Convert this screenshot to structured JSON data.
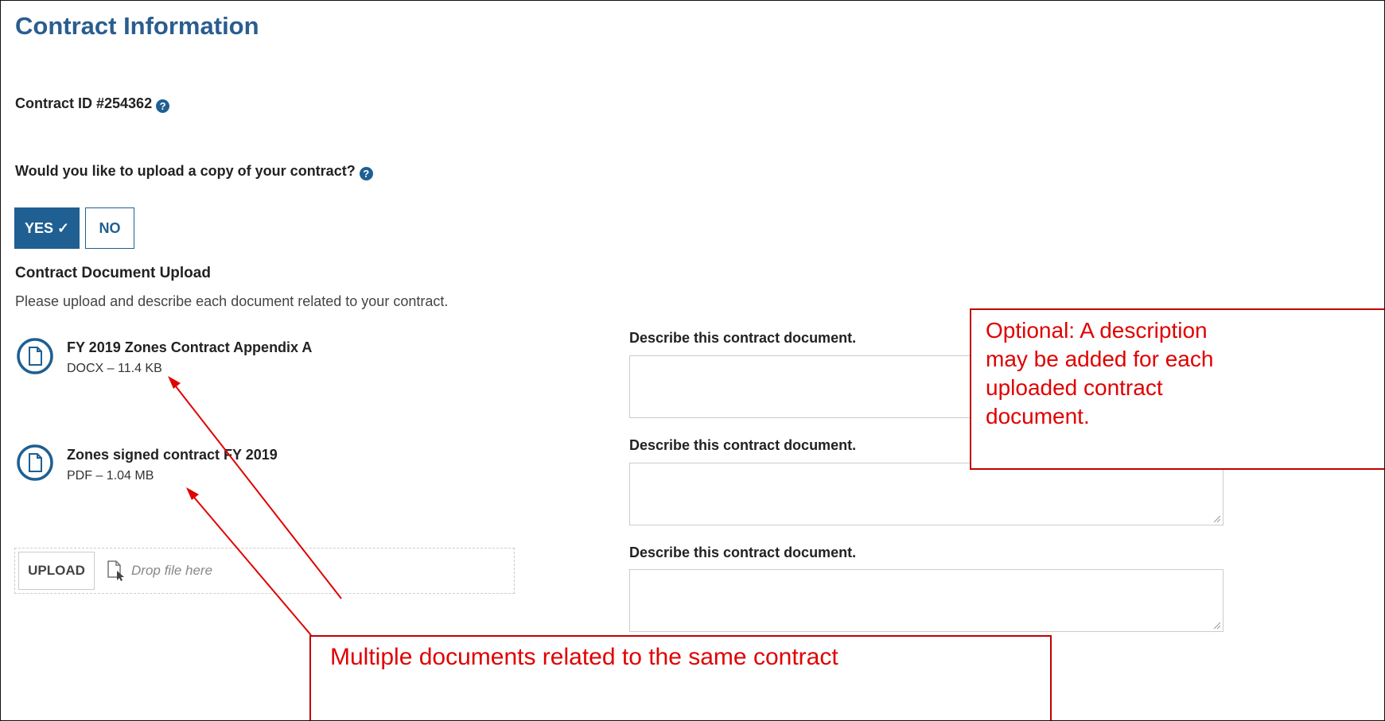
{
  "page": {
    "title": "Contract Information",
    "contract_id_label": "Contract ID #254362",
    "upload_question": "Would you like to upload a copy of your contract?",
    "help_icon": "question-circle-icon"
  },
  "toggle": {
    "yes_label": "YES ✓",
    "no_label": "NO",
    "selected": "YES"
  },
  "upload": {
    "heading": "Contract Document Upload",
    "instructions": "Please upload and describe each document related to your contract.",
    "files": [
      {
        "name": "FY 2019 Zones Contract Appendix A",
        "meta": "DOCX – 11.4 KB",
        "icon": "file-icon"
      },
      {
        "name": "Zones signed contract FY 2019",
        "meta": "PDF – 1.04 MB",
        "icon": "file-icon"
      }
    ],
    "describe_label": "Describe this contract document.",
    "upload_button": "UPLOAD",
    "drop_placeholder": "Drop file here"
  },
  "callouts": {
    "description_note": [
      "Optional:  A description",
      "may be added for each",
      "uploaded contract",
      "document."
    ],
    "multiple_docs_note": "Multiple documents related to the same contract"
  },
  "colors": {
    "brand": "#1f5f92",
    "title": "#2a5d8f",
    "annotation": "#e00000"
  }
}
